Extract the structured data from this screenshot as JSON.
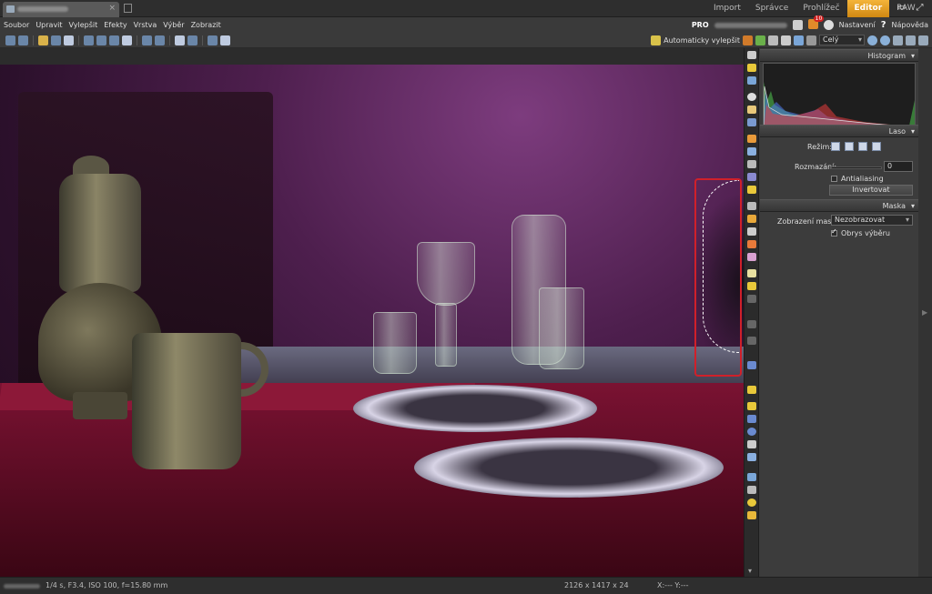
{
  "document_tab": {
    "close_label": "×"
  },
  "modes": [
    "Import",
    "Správce",
    "Prohlížeč",
    "Editor",
    "RAW"
  ],
  "menu": [
    "Soubor",
    "Upravit",
    "Vylepšit",
    "Efekty",
    "Vrstva",
    "Výběr",
    "Zobrazit"
  ],
  "header_right": {
    "pro": "PRO",
    "notification_count": "10",
    "settings": "Nastavení",
    "help_icon": "?",
    "help": "Nápověda"
  },
  "toolbar": {
    "auto_enhance": "Automaticky vylepšit",
    "zoom_value": "Celý"
  },
  "panel": {
    "histogram_title": "Histogram",
    "lasso_title": "Laso",
    "mode_label": "Režim:",
    "blur_label": "Rozmazání:",
    "blur_value": "0",
    "antialiasing_label": "Antialiasing",
    "antialiasing_checked": false,
    "invert_button": "Invertovat",
    "mask_title": "Maska",
    "mask_display_label": "Zobrazení masky:",
    "mask_display_value": "Nezobrazovat",
    "selection_outline_label": "Obrys výběru",
    "selection_outline_checked": true,
    "collapse_arrow": "▾",
    "edge_arrow": "▶"
  },
  "status": {
    "exposure": "1/4 s, F3.4, ISO 100, f=15.80 mm",
    "dimensions": "2126 x 1417 x 24",
    "coords": "X:---   Y:---"
  },
  "colors": {
    "accent": "#e8a020",
    "selection_highlight": "#d0202a"
  }
}
